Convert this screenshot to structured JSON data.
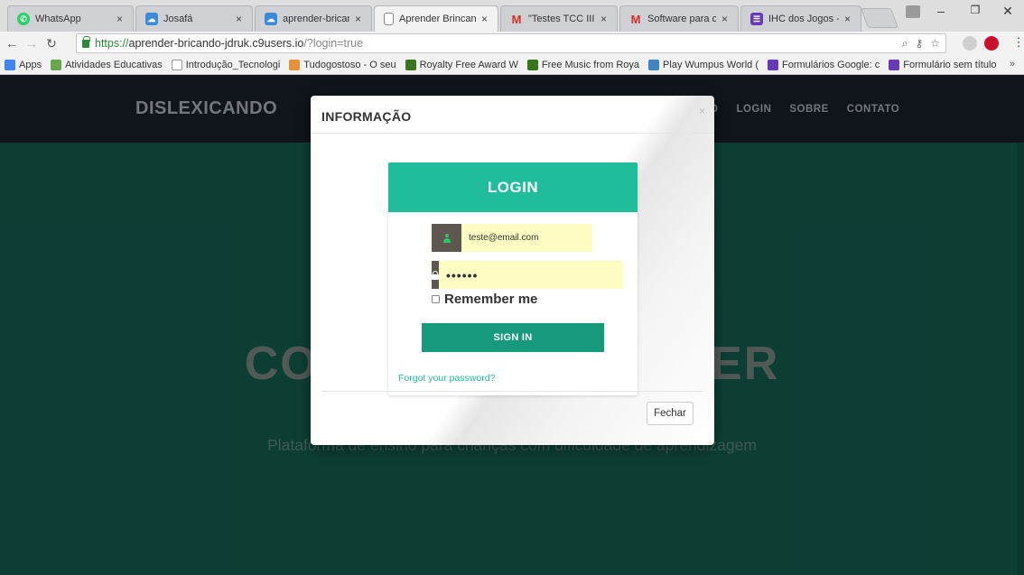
{
  "browser": {
    "tabs": [
      {
        "label": "WhatsApp",
        "icon": "whatsapp-icon",
        "color": "#25d366"
      },
      {
        "label": "Josafá",
        "icon": "cloud9-icon",
        "color": "#3b8cd8"
      },
      {
        "label": "aprender-bricando",
        "icon": "cloud9-icon",
        "color": "#3b8cd8"
      },
      {
        "label": "Aprender Brincand",
        "icon": "document-icon",
        "color": "#ffffff"
      },
      {
        "label": "\"Testes TCC III\" - ja",
        "icon": "gmail-icon",
        "color": "#d93025"
      },
      {
        "label": "Software para crian",
        "icon": "gmail-icon",
        "color": "#d93025"
      },
      {
        "label": "IHC dos Jogos - Fo",
        "icon": "forms-icon",
        "color": "#673ab7"
      }
    ],
    "url": {
      "https": "https://",
      "host": "aprender-bricando-jdruk.c9users.io",
      "path": "/?login=true"
    },
    "bookmarks": [
      {
        "label": "Apps",
        "icon": "apps-icon",
        "color": "#4285f4"
      },
      {
        "label": "Atividades Educativas",
        "icon": "bookmark-icon",
        "color": "#6aa84f"
      },
      {
        "label": "Introdução_Tecnologi",
        "icon": "page-icon",
        "color": "#999999"
      },
      {
        "label": "Tudogostoso - O seu",
        "icon": "food-icon",
        "color": "#e69138"
      },
      {
        "label": "Royalty Free Award W",
        "icon": "music-icon",
        "color": "#38761d"
      },
      {
        "label": "Free Music from Roya",
        "icon": "music-icon",
        "color": "#38761d"
      },
      {
        "label": "Play Wumpus World (",
        "icon": "game-icon",
        "color": "#3d85c6"
      },
      {
        "label": "Formulários Google: c",
        "icon": "forms-icon",
        "color": "#673ab7"
      },
      {
        "label": "Formulário sem título",
        "icon": "forms-icon",
        "color": "#673ab7"
      }
    ],
    "bookmarks_more": "»"
  },
  "site": {
    "brand": "DISLEXICANDO",
    "nav": [
      "O",
      "LOGIN",
      "SOBRE",
      "CONTATO"
    ],
    "hero_title": "CO                        BER",
    "hero_subtitle": "Plataforma de ensino para crianças com dificuldade de aprendizagem"
  },
  "modal": {
    "title": "INFORMAÇÃO",
    "close": "×",
    "close_button": "Fechar",
    "login": {
      "heading": "LOGIN",
      "email_value": "teste@email.com",
      "password_value": "••••••",
      "remember_label": "Remember me",
      "signin_label": "SIGN IN",
      "forgot_label": "Forgot your password?"
    }
  },
  "colors": {
    "nav_bg": "#1b2530",
    "hero_bg": "#176b5b",
    "login_accent": "#1fbd9c",
    "signin_bg": "#16997d",
    "input_bg": "#fdfdc4"
  }
}
